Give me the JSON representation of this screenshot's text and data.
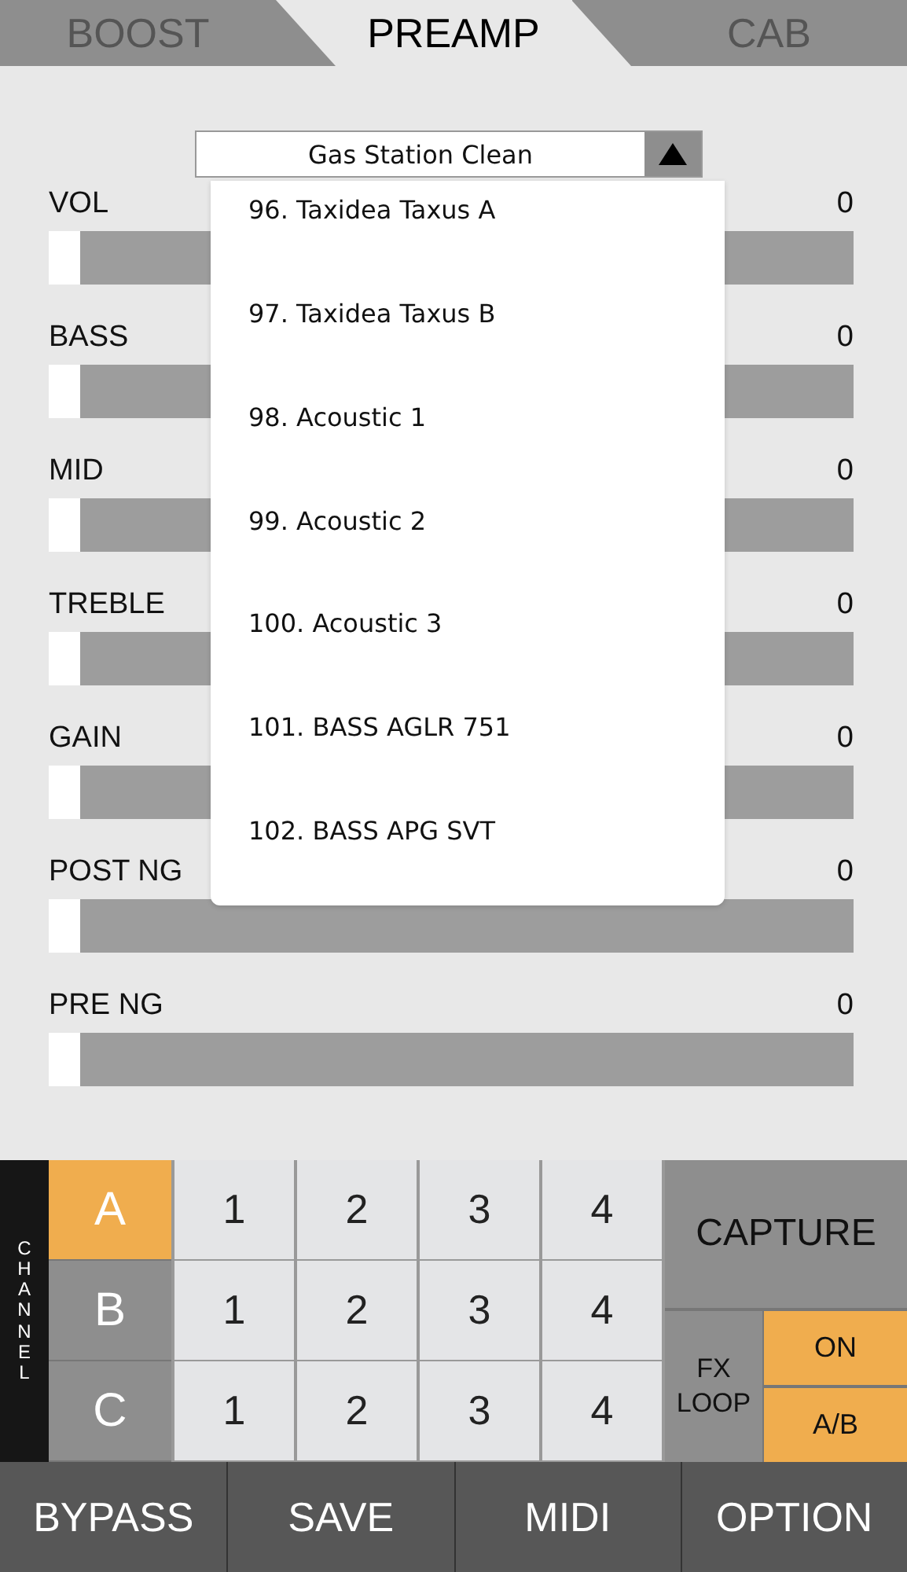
{
  "tabs": [
    {
      "label": "BOOST",
      "selected": false
    },
    {
      "label": "PREAMP",
      "selected": true
    },
    {
      "label": "CAB",
      "selected": false
    }
  ],
  "preset_select": {
    "value": "Gas Station Clean",
    "expanded": true
  },
  "dropdown_items": [
    "96. Taxidea Taxus A",
    "97. Taxidea Taxus B",
    "98. Acoustic 1",
    "99. Acoustic 2",
    "100. Acoustic 3",
    "101. BASS AGLR 751",
    "102. BASS APG SVT"
  ],
  "sliders": [
    {
      "name": "VOL",
      "reading": "0",
      "level": 0
    },
    {
      "name": "BASS",
      "reading": "0",
      "level": 0
    },
    {
      "name": "MID",
      "reading": "0",
      "level": 0
    },
    {
      "name": "TREBLE",
      "reading": "0",
      "level": 0
    },
    {
      "name": "GAIN",
      "reading": "0",
      "level": 0
    },
    {
      "name": "POST NG",
      "reading": "0",
      "level": 0
    },
    {
      "name": "PRE NG",
      "reading": "0",
      "level": 0
    }
  ],
  "channel_label": "CHANNEL",
  "channels": [
    {
      "label": "A",
      "selected": true,
      "slots": [
        {
          "label": "1",
          "selected": false
        },
        {
          "label": "2",
          "selected": false
        },
        {
          "label": "3",
          "selected": false
        },
        {
          "label": "4",
          "selected": false
        }
      ]
    },
    {
      "label": "B",
      "selected": false,
      "slots": [
        {
          "label": "1",
          "selected": false
        },
        {
          "label": "2",
          "selected": false
        },
        {
          "label": "3",
          "selected": false
        },
        {
          "label": "4",
          "selected": false
        }
      ]
    },
    {
      "label": "C",
      "selected": false,
      "slots": [
        {
          "label": "1",
          "selected": false
        },
        {
          "label": "2",
          "selected": false
        },
        {
          "label": "3",
          "selected": false
        },
        {
          "label": "4",
          "selected": false
        }
      ]
    }
  ],
  "capture": "CAPTURE",
  "fx_loop": {
    "label": "FX LOOP",
    "buttons": [
      {
        "label": "ON",
        "on": true
      },
      {
        "label": "A/B",
        "on": true
      }
    ]
  },
  "bottom_buttons": [
    "BYPASS",
    "SAVE",
    "MIDI",
    "OPTION"
  ]
}
